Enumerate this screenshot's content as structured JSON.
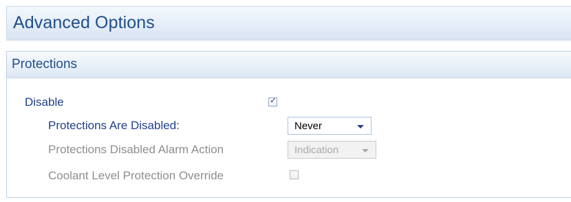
{
  "header": {
    "title": "Advanced Options"
  },
  "panel": {
    "title": "Protections"
  },
  "rows": {
    "disable": {
      "label": "Disable",
      "checked": true
    },
    "protections_are_disabled": {
      "label": "Protections Are Disabled:",
      "selected": "Never"
    },
    "alarm_action": {
      "label": "Protections Disabled Alarm Action",
      "selected": "Indication",
      "enabled": false
    },
    "coolant_override": {
      "label": "Coolant Level Protection Override",
      "checked": false,
      "enabled": false
    }
  },
  "icons": {
    "check": "✓"
  },
  "colors": {
    "label_text": "#1f3f8a",
    "disabled_text": "#8e8e8e",
    "header_text": "#1f4e8c"
  }
}
